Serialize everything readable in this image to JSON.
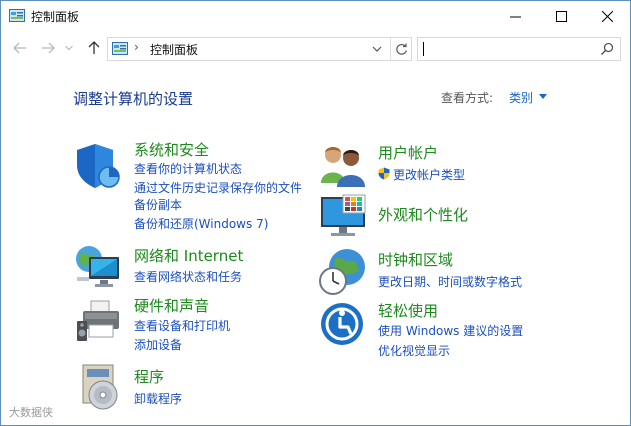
{
  "window": {
    "title": "控制面板"
  },
  "address": {
    "path": "控制面板",
    "separator": "›"
  },
  "search": {
    "placeholder": ""
  },
  "page": {
    "title": "调整计算机的设置",
    "view_by_label": "查看方式:",
    "view_by_value": "类别"
  },
  "categories": {
    "system": {
      "title": "系统和安全",
      "links": [
        "查看你的计算机状态",
        "通过文件历史记录保存你的文件",
        "备份副本",
        "备份和还原(Windows 7)"
      ]
    },
    "network": {
      "title": "网络和 Internet",
      "links": [
        "查看网络状态和任务"
      ]
    },
    "hardware": {
      "title": "硬件和声音",
      "links": [
        "查看设备和打印机",
        "添加设备"
      ]
    },
    "programs": {
      "title": "程序",
      "links": [
        "卸载程序"
      ]
    },
    "accounts": {
      "title": "用户帐户",
      "links": [
        "更改帐户类型"
      ]
    },
    "appearance": {
      "title": "外观和个性化",
      "links": []
    },
    "clock": {
      "title": "时钟和区域",
      "links": [
        "更改日期、时间或数字格式"
      ]
    },
    "ease": {
      "title": "轻松使用",
      "links": [
        "使用 Windows 建议的设置",
        "优化视觉显示"
      ]
    }
  },
  "watermark": "大数据侠",
  "colors": {
    "category_title": "#1c8a1c",
    "link": "#1a4fbf",
    "page_title": "#1a3a8f",
    "accent": "#1a66cc"
  }
}
